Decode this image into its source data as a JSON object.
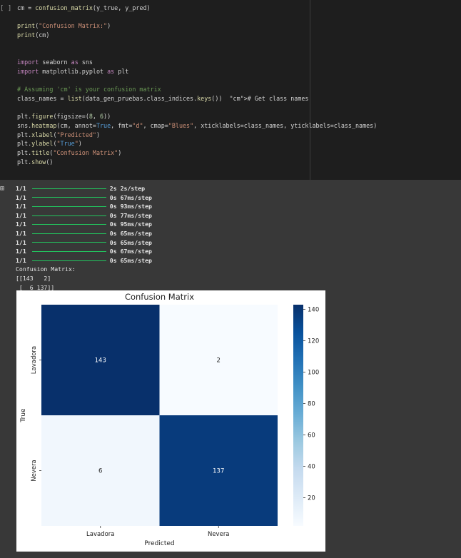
{
  "cell": {
    "run_indicator": "[ ]",
    "lines": [
      [
        [
          "confusion_matrix",
          "cm = confusion_matrix(y_true, y_pred)",
          "plain"
        ]
      ],
      [],
      [
        [
          "print1",
          "print(\"Confusion Matrix:\")",
          "plain"
        ]
      ],
      [
        [
          "print2",
          "print(cm)",
          "plain"
        ]
      ],
      [],
      [],
      [
        [
          "imp1",
          "import seaborn as sns",
          "plain"
        ]
      ],
      [
        [
          "imp2",
          "import matplotlib.pyplot as plt",
          "plain"
        ]
      ],
      [],
      [
        [
          "comment",
          "# Assuming 'cm' is your confusion matrix",
          "cm"
        ]
      ],
      [
        [
          "classnames",
          "class_names = list(data_gen_pruebas.class_indices.keys())  # Get class names",
          "plain"
        ]
      ],
      [],
      [
        [
          "fig",
          "plt.figure(figsize=(8, 6))",
          "plain"
        ]
      ],
      [
        [
          "heat",
          "sns.heatmap(cm, annot=True, fmt=\"d\", cmap=\"Blues\", xticklabels=class_names, yticklabels=class_names)",
          "plain"
        ]
      ],
      [
        [
          "xl",
          "plt.xlabel(\"Predicted\")",
          "plain"
        ]
      ],
      [
        [
          "yl",
          "plt.ylabel(\"True\")",
          "plain"
        ]
      ],
      [
        [
          "tl",
          "plt.title(\"Confusion Matrix\")",
          "plain"
        ]
      ],
      [
        [
          "show",
          "plt.show()",
          "plain"
        ]
      ]
    ]
  },
  "output": {
    "icon": "output-toggle-icon",
    "progress_lines": [
      {
        "step": "1/1",
        "time": "2s 2s/step"
      },
      {
        "step": "1/1",
        "time": "0s 67ms/step"
      },
      {
        "step": "1/1",
        "time": "0s 93ms/step"
      },
      {
        "step": "1/1",
        "time": "0s 77ms/step"
      },
      {
        "step": "1/1",
        "time": "0s 95ms/step"
      },
      {
        "step": "1/1",
        "time": "0s 65ms/step"
      },
      {
        "step": "1/1",
        "time": "0s 65ms/step"
      },
      {
        "step": "1/1",
        "time": "0s 67ms/step"
      },
      {
        "step": "1/1",
        "time": "0s 65ms/step"
      }
    ],
    "text_lines": [
      "Confusion Matrix:",
      "[[143   2]",
      " [  6 137]]"
    ]
  },
  "chart_data": {
    "type": "heatmap",
    "title": "Confusion Matrix",
    "xlabel": "Predicted",
    "ylabel": "True",
    "x_categories": [
      "Lavadora",
      "Nevera"
    ],
    "y_categories": [
      "Lavadora",
      "Nevera"
    ],
    "values": [
      [
        143,
        2
      ],
      [
        6,
        137
      ]
    ],
    "colormap": "Blues",
    "colorbar_ticks": [
      20,
      40,
      60,
      80,
      100,
      120,
      140
    ],
    "colorbar_range": [
      2,
      143
    ],
    "colors": {
      "low": "#f7fbff",
      "high": "#08306b"
    }
  }
}
